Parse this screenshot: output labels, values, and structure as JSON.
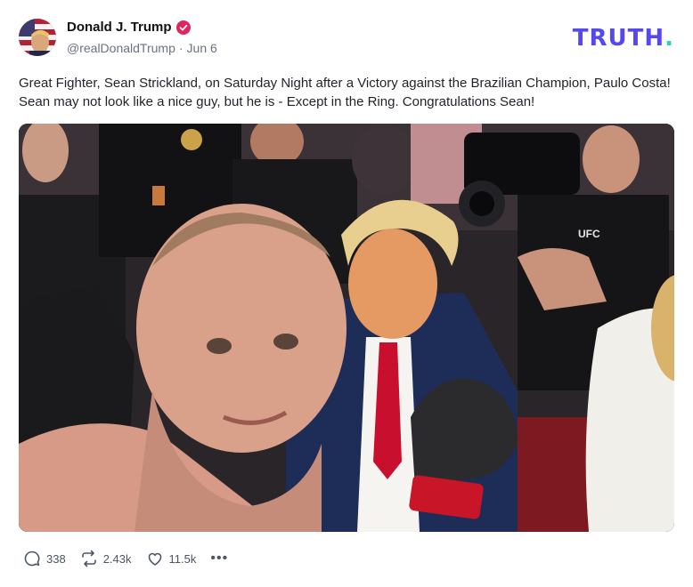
{
  "author": {
    "name": "Donald J. Trump",
    "handle": "@realDonaldTrump",
    "date": "Jun 6",
    "separator": "·"
  },
  "brand": {
    "wordmark": "TRUTH",
    "dot": ".",
    "color": "#5448ee",
    "dot_color": "#21d3c0"
  },
  "post": {
    "text": "Great Fighter, Sean Strickland, on Saturday Night after a Victory against the Brazilian Champion, Paulo Costa! Sean may not look like a nice guy, but he is - Except in the Ring. Congratulations Sean!"
  },
  "photo": {
    "shirt_logo": "UFC"
  },
  "actions": {
    "replies": "338",
    "retruths": "2.43k",
    "likes": "11.5k",
    "more": "•••"
  },
  "icons": [
    "verified-badge-icon",
    "reply-icon",
    "retruth-icon",
    "like-icon",
    "more-icon"
  ]
}
